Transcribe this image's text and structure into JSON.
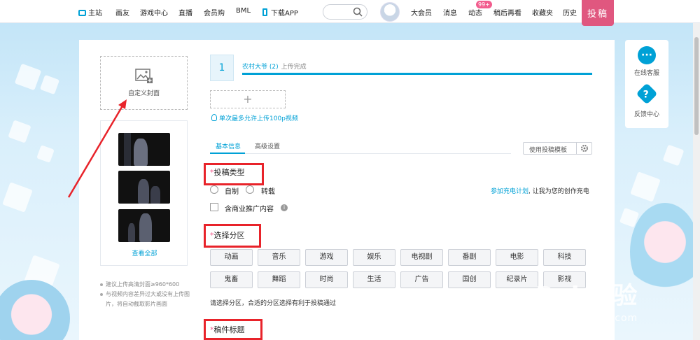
{
  "topbar": {
    "nav": [
      {
        "label": "主站",
        "icon": "tv-icon"
      },
      {
        "label": "画友"
      },
      {
        "label": "游戏中心"
      },
      {
        "label": "直播"
      },
      {
        "label": "会员购"
      },
      {
        "label": "BML"
      },
      {
        "label": "下载APP",
        "icon": "phone-icon"
      }
    ],
    "right_nav": [
      "大会员",
      "消息",
      "动态",
      "稍后再看",
      "收藏夹",
      "历史"
    ],
    "dynamic_badge": "99+",
    "upload_label": "投稿"
  },
  "cover": {
    "label": "自定义封面",
    "view_all": "查看全部",
    "tips": [
      "建议上传高清封面≥960*600",
      "与视频内容差异过大或没有上传图片，将自动截取影片画面"
    ]
  },
  "upload": {
    "index": "1",
    "file_name": "农村大爷 (2)",
    "status": "上传完成",
    "progress": 1.0,
    "add_symbol": "+",
    "hint": "单次最多允许上传100p视频"
  },
  "tabs": {
    "items": [
      "基本信息",
      "高级设置"
    ],
    "active": 0,
    "template_button": "使用投稿模板"
  },
  "type_section": {
    "title": "投稿类型",
    "required_mark": "*",
    "options": [
      "自制",
      "转载"
    ],
    "commercial_label": "含商业推广内容",
    "charge_link": "参加充电计划",
    "charge_text": ", 让我为您的创作充电"
  },
  "category_section": {
    "title": "选择分区",
    "required_mark": "*",
    "categories": [
      "动画",
      "音乐",
      "游戏",
      "娱乐",
      "电视剧",
      "番剧",
      "电影",
      "科技",
      "鬼畜",
      "舞蹈",
      "时尚",
      "生活",
      "广告",
      "国创",
      "纪录片",
      "影视"
    ],
    "tip": "请选择分区，合适的分区选择有利于投稿通过"
  },
  "title_section": {
    "title": "稿件标题",
    "required_mark": "*"
  },
  "side_float": {
    "service_label": "在线客服",
    "feedback_label": "反馈中心",
    "feedback_glyph": "?"
  },
  "watermark": {
    "main": "Bai 经验",
    "sub": "jingyan.baidu.com"
  },
  "colors": {
    "accent": "#00a1d6",
    "pink": "#e0577f",
    "annotation_red": "#e8232a"
  }
}
